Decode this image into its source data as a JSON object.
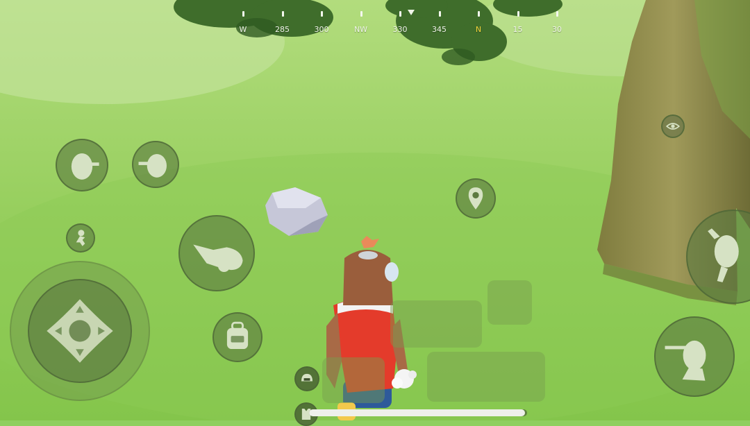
{
  "compass": {
    "ticks": [
      {
        "label": "W",
        "highlight": false
      },
      {
        "label": "285",
        "highlight": false
      },
      {
        "label": "300",
        "highlight": false
      },
      {
        "label": "NW",
        "highlight": false
      },
      {
        "label": "330",
        "highlight": false
      },
      {
        "label": "345",
        "highlight": false
      },
      {
        "label": "N",
        "highlight": true
      },
      {
        "label": "15",
        "highlight": false
      },
      {
        "label": "30",
        "highlight": false
      }
    ],
    "highlight_color": "#f3d23a"
  },
  "controls": {
    "lean_left_icon": "peek-left-icon",
    "lean_right_icon": "peek-right-icon",
    "sprint_icon": "running-figure-icon",
    "joystick_icon": "dpad-joystick-icon",
    "prone_icon": "prone-dive-icon",
    "backpack_icon": "backpack-icon",
    "map_marker_icon": "map-pin-icon",
    "eye_icon": "eye-icon",
    "jump_icon": "jump-figure-icon",
    "fire_icon": "crouch-shoot-icon",
    "helmet_icon": "helmet-icon",
    "armor_icon": "vest-icon"
  },
  "health": {
    "fraction": 0.99
  },
  "colors": {
    "sky_grass": "#9fd46a",
    "button_fill": "#5c7a40",
    "tree_trunk": "#8c8a47",
    "player_shirt": "#e43b2b"
  }
}
